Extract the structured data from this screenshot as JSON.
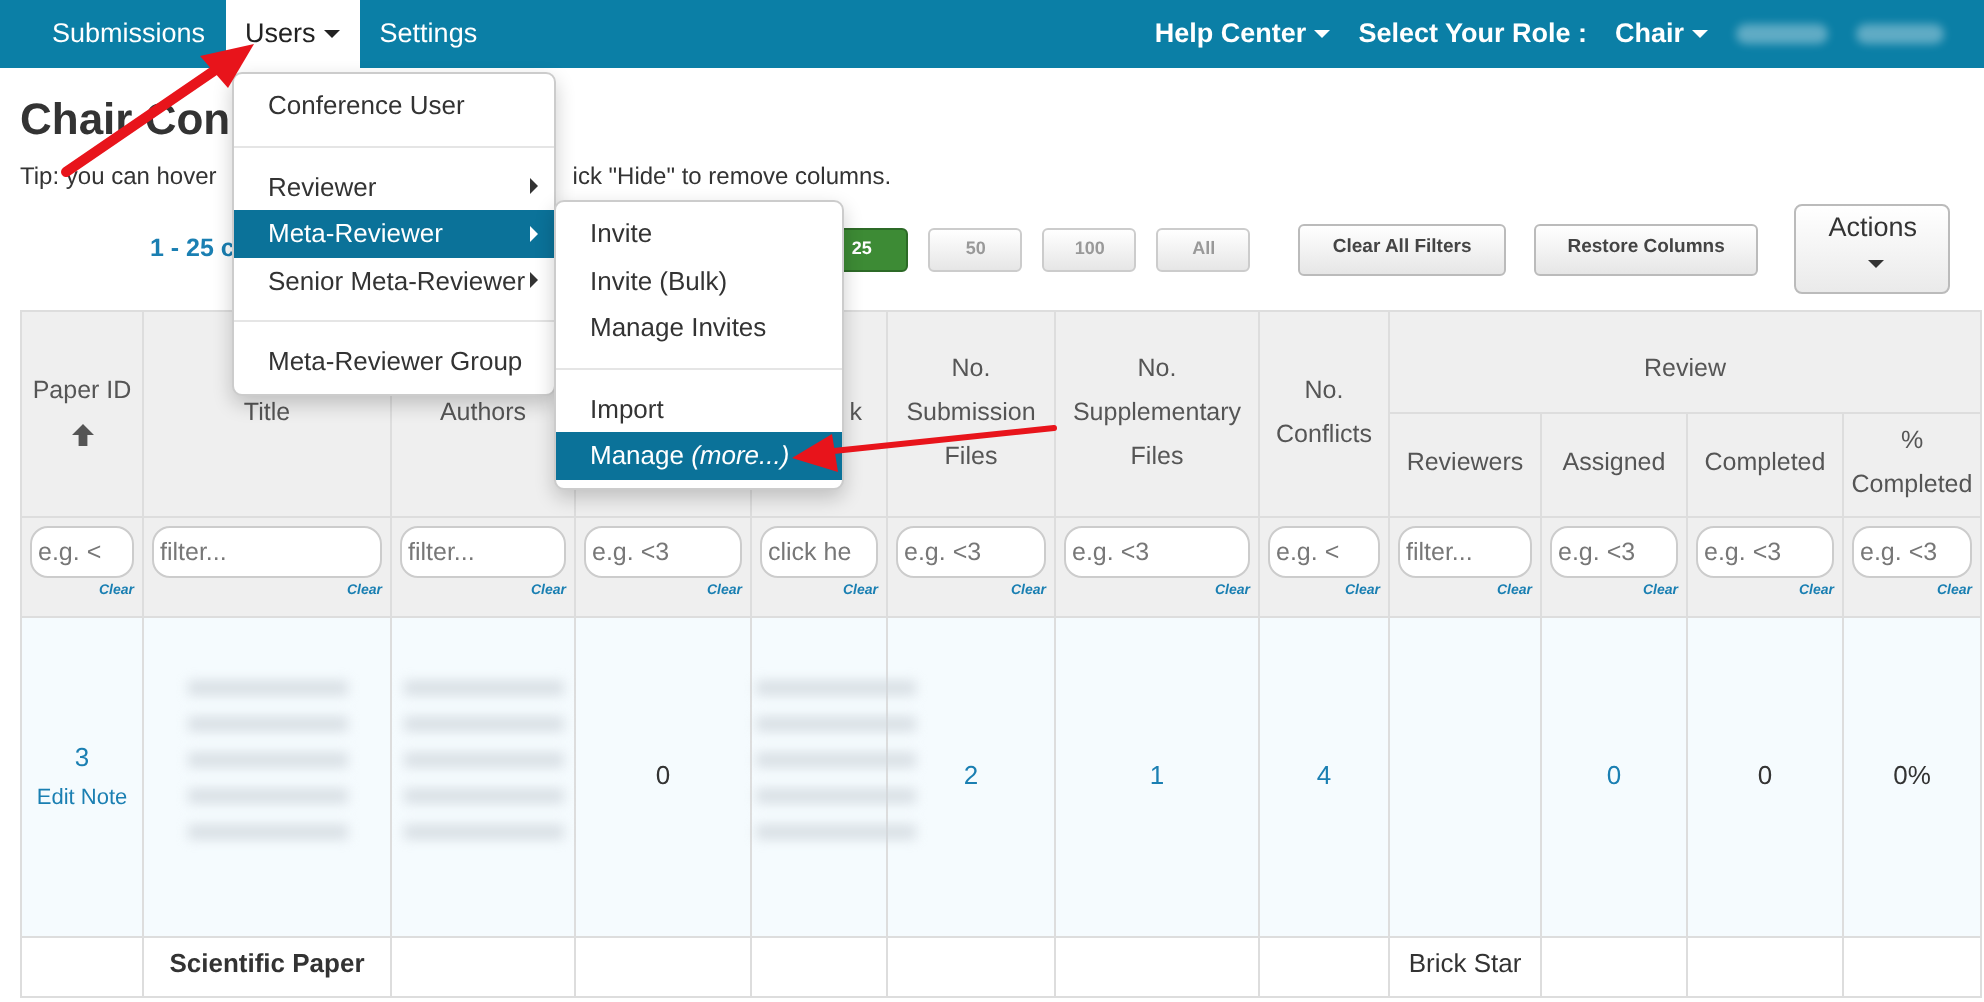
{
  "navbar": {
    "tabs": [
      {
        "label": "Submissions",
        "selected": false,
        "dropdown": false
      },
      {
        "label": "Users",
        "selected": true,
        "dropdown": true
      },
      {
        "label": "Settings",
        "selected": false,
        "dropdown": false
      }
    ],
    "right": [
      {
        "kind": "dropdown",
        "label": "Help Center"
      },
      {
        "kind": "text",
        "label": "Select Your Role :"
      },
      {
        "kind": "dropdown",
        "label": "Chair"
      }
    ]
  },
  "page": {
    "title": "Chair Con",
    "tip": [
      "Tip: you can hover",
      "ick \"Hide\" to remove columns."
    ]
  },
  "pagination": {
    "range": "1 - 25 c",
    "page_sizes": [
      {
        "label": "25",
        "selected": true
      },
      {
        "label": "50",
        "selected": false
      },
      {
        "label": "100",
        "selected": false
      },
      {
        "label": "All",
        "selected": false
      }
    ]
  },
  "toolbar_buttons": [
    "Clear All Filters",
    "Restore Columns"
  ],
  "actions_button": "Actions",
  "table": {
    "columns": [
      {
        "label": "Paper ID",
        "sort_ascending": true,
        "filter_placeholder": "e.g. <",
        "clear": "Clear"
      },
      {
        "label": "Title",
        "filter_placeholder": "filter...",
        "clear": "Clear"
      },
      {
        "label": "Authors",
        "filter_placeholder": "filter...",
        "clear": "Clear"
      },
      {
        "filter_placeholder": "e.g. <3",
        "clear": "Clear"
      },
      {
        "label": "k",
        "filter_placeholder": "click he",
        "clear": "Clear"
      },
      {
        "label": "No. Submission Files",
        "filter_placeholder": "e.g. <3",
        "clear": "Clear"
      },
      {
        "label": "No. Supplementary Files",
        "filter_placeholder": "e.g. <3",
        "clear": "Clear"
      },
      {
        "label": "No. Conflicts",
        "filter_placeholder": "e.g. <",
        "clear": "Clear"
      }
    ],
    "groups": [
      {
        "label": "Review",
        "columns": [
          {
            "label": "Reviewers",
            "filter_placeholder": "filter...",
            "clear": "Clear"
          },
          {
            "label": "Assigned",
            "filter_placeholder": "e.g. <3",
            "clear": "Clear"
          },
          {
            "label": "Completed",
            "filter_placeholder": "e.g. <3",
            "clear": "Clear"
          },
          {
            "label": "% Completed",
            "filter_placeholder": "e.g. <3",
            "clear": "Clear"
          }
        ]
      }
    ],
    "rows": [
      {
        "highlighted": true,
        "cells": [
          {
            "kind": "id",
            "text": "3",
            "note": "Edit Note"
          },
          {
            "kind": "blurred"
          },
          {
            "kind": "blurred"
          },
          {
            "kind": "text",
            "text": "0"
          },
          {
            "kind": "blurred"
          },
          {
            "kind": "link",
            "text": "2"
          },
          {
            "kind": "link",
            "text": "1"
          },
          {
            "kind": "link",
            "text": "4"
          },
          {
            "kind": "empty"
          },
          {
            "kind": "link",
            "text": "0"
          },
          {
            "kind": "text",
            "text": "0"
          },
          {
            "kind": "text",
            "text": "0%"
          }
        ]
      },
      {
        "highlighted": false,
        "cells": [
          {
            "kind": "empty"
          },
          {
            "kind": "bold",
            "text": "Scientific Paper"
          },
          {
            "kind": "empty"
          },
          {
            "kind": "empty"
          },
          {
            "kind": "empty"
          },
          {
            "kind": "empty"
          },
          {
            "kind": "empty"
          },
          {
            "kind": "empty"
          },
          {
            "kind": "text",
            "text": "Brick Star"
          },
          {
            "kind": "empty"
          },
          {
            "kind": "empty"
          },
          {
            "kind": "empty"
          }
        ]
      }
    ]
  },
  "users_menu": {
    "items": [
      {
        "kind": "item",
        "label": "Conference User",
        "submenu": false,
        "selected": false
      },
      {
        "kind": "divider"
      },
      {
        "kind": "item",
        "label": "Reviewer",
        "submenu": true,
        "selected": false
      },
      {
        "kind": "item",
        "label": "Meta-Reviewer",
        "submenu": true,
        "selected": true
      },
      {
        "kind": "item",
        "label": "Senior Meta-Reviewer",
        "submenu": true,
        "selected": false
      },
      {
        "kind": "divider"
      },
      {
        "kind": "item",
        "label": "Meta-Reviewer Group",
        "submenu": false,
        "selected": false
      }
    ]
  },
  "submenu": {
    "items": [
      {
        "kind": "item",
        "label": "Invite",
        "selected": false
      },
      {
        "kind": "item",
        "label": "Invite (Bulk)",
        "selected": false
      },
      {
        "kind": "item",
        "label": "Manage Invites",
        "selected": false
      },
      {
        "kind": "divider"
      },
      {
        "kind": "item",
        "label": "Import",
        "selected": false
      },
      {
        "kind": "item",
        "label": "Manage *(more...)*",
        "selected": true
      }
    ]
  }
}
